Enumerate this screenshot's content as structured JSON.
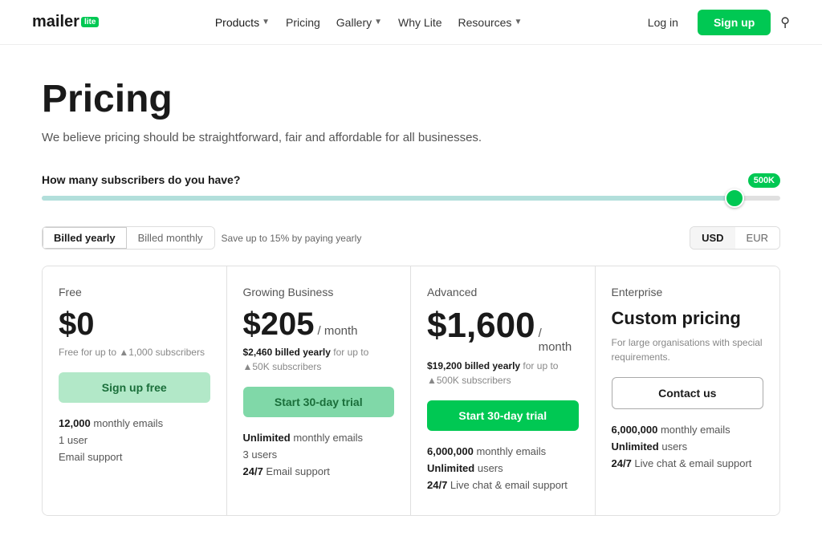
{
  "header": {
    "logo_mailer": "mailer",
    "logo_lite": "lite",
    "nav": [
      {
        "label": "Products",
        "hasChevron": true,
        "active": true
      },
      {
        "label": "Pricing",
        "hasChevron": false,
        "active": false
      },
      {
        "label": "Gallery",
        "hasChevron": true,
        "active": false
      },
      {
        "label": "Why Lite",
        "hasChevron": false,
        "active": false
      },
      {
        "label": "Resources",
        "hasChevron": true,
        "active": false
      }
    ],
    "login_label": "Log in",
    "signup_label": "Sign up"
  },
  "hero": {
    "title": "Pricing",
    "subtitle": "We believe pricing should be straightforward, fair and affordable for all businesses."
  },
  "slider": {
    "label": "How many subscribers do you have?",
    "badge": "500K",
    "value": 95,
    "min": 0,
    "max": 100
  },
  "billing": {
    "yearly_label": "Billed yearly",
    "monthly_label": "Billed monthly",
    "save_note": "Save up to 15% by paying yearly",
    "usd_label": "USD",
    "eur_label": "EUR"
  },
  "plans": [
    {
      "tier": "Free",
      "price": "$0",
      "price_suffix": "",
      "billing_detail": "Free for up to ▲1,000 subscribers",
      "cta": "Sign up free",
      "cta_type": "free",
      "features": [
        {
          "text": "12,000 monthly emails",
          "bold_part": "12,000"
        },
        {
          "text": "1 user",
          "bold_part": ""
        },
        {
          "text": "Email support",
          "bold_part": ""
        }
      ]
    },
    {
      "tier": "Growing Business",
      "price": "$205",
      "price_suffix": "/ month",
      "billing_detail": "$2,460 billed yearly for up to ▲50K subscribers",
      "billing_detail_bold": "$2,460 billed yearly",
      "cta": "Start 30-day trial",
      "cta_type": "trial",
      "features": [
        {
          "text": "Unlimited monthly emails",
          "bold_part": "Unlimited"
        },
        {
          "text": "3 users",
          "bold_part": ""
        },
        {
          "text": "24/7 Email support",
          "bold_part": "24/7"
        }
      ]
    },
    {
      "tier": "Advanced",
      "price": "$1,600",
      "price_suffix": "/ month",
      "billing_detail": "$19,200 billed yearly for up to ▲500K subscribers",
      "billing_detail_bold": "$19,200 billed yearly",
      "cta": "Start 30-day trial",
      "cta_type": "trial-dark",
      "features": [
        {
          "text": "6,000,000 monthly emails",
          "bold_part": "6,000,000"
        },
        {
          "text": "Unlimited users",
          "bold_part": "Unlimited"
        },
        {
          "text": "24/7 Live chat & email support",
          "bold_part": "24/7"
        }
      ]
    },
    {
      "tier": "Enterprise",
      "price": "Custom pricing",
      "price_suffix": "",
      "billing_detail": "For large organisations with special requirements.",
      "cta": "Contact us",
      "cta_type": "contact",
      "features": [
        {
          "text": "6,000,000 monthly emails",
          "bold_part": "6,000,000"
        },
        {
          "text": "Unlimited users",
          "bold_part": "Unlimited"
        },
        {
          "text": "24/7 Live chat & email support",
          "bold_part": "24/7"
        }
      ]
    }
  ]
}
